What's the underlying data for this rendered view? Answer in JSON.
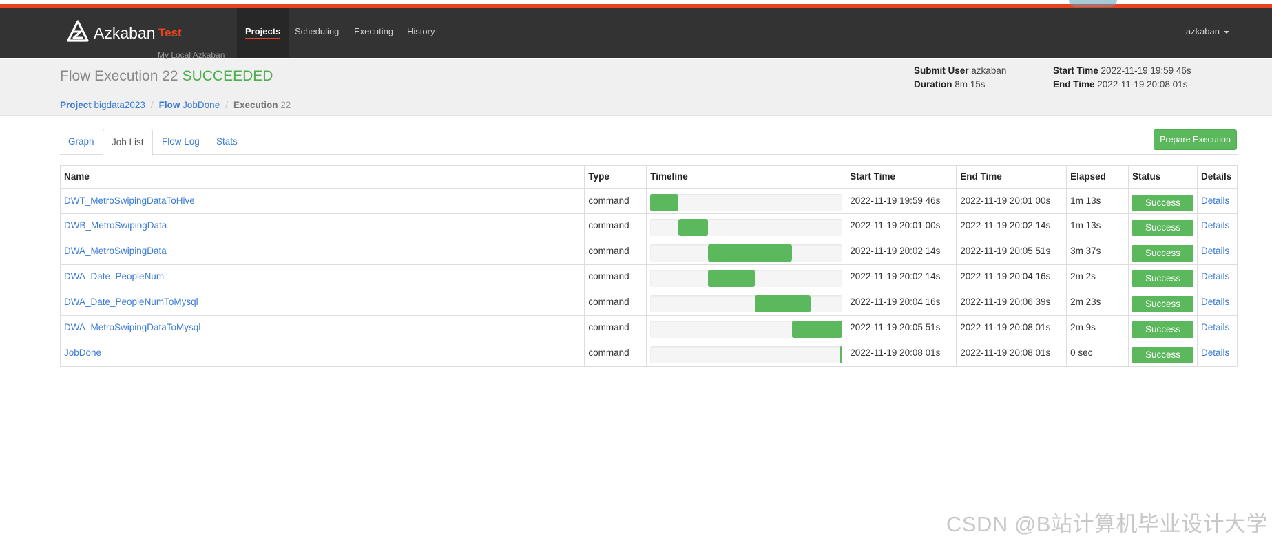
{
  "brand": {
    "name": "Azkaban",
    "env": "Test",
    "subtitle": "My Local Azkaban"
  },
  "nav": {
    "items": [
      {
        "label": "Projects",
        "active": true
      },
      {
        "label": "Scheduling",
        "active": false
      },
      {
        "label": "Executing",
        "active": false
      },
      {
        "label": "History",
        "active": false
      }
    ],
    "user": "azkaban"
  },
  "header": {
    "title": "Flow Execution 22",
    "status": "SUCCEEDED",
    "submit_user_label": "Submit User",
    "submit_user": "azkaban",
    "duration_label": "Duration",
    "duration": "8m 15s",
    "start_time_label": "Start Time",
    "start_time": "2022-11-19 19:59 46s",
    "end_time_label": "End Time",
    "end_time": "2022-11-19 20:08 01s"
  },
  "breadcrumb": {
    "project_label": "Project",
    "project": "bigdata2023",
    "flow_label": "Flow",
    "flow": "JobDone",
    "execution_label": "Execution",
    "execution": "22"
  },
  "tabs": [
    {
      "label": "Graph",
      "active": false
    },
    {
      "label": "Job List",
      "active": true
    },
    {
      "label": "Flow Log",
      "active": false
    },
    {
      "label": "Stats",
      "active": false
    }
  ],
  "prepare_button": "Prepare Execution",
  "table": {
    "columns": [
      "Name",
      "Type",
      "Timeline",
      "Start Time",
      "End Time",
      "Elapsed",
      "Status",
      "Details"
    ],
    "rows": [
      {
        "name": "DWT_MetroSwipingDataToHive",
        "type": "command",
        "timeline": {
          "start": 0.0,
          "end": 0.148
        },
        "start": "2022-11-19 19:59 46s",
        "end": "2022-11-19 20:01 00s",
        "elapsed": "1m 13s",
        "status": "Success",
        "details": "Details"
      },
      {
        "name": "DWB_MetroSwipingData",
        "type": "command",
        "timeline": {
          "start": 0.148,
          "end": 0.301
        },
        "start": "2022-11-19 20:01 00s",
        "end": "2022-11-19 20:02 14s",
        "elapsed": "1m 13s",
        "status": "Success",
        "details": "Details"
      },
      {
        "name": "DWA_MetroSwipingData",
        "type": "command",
        "timeline": {
          "start": 0.301,
          "end": 0.739
        },
        "start": "2022-11-19 20:02 14s",
        "end": "2022-11-19 20:05 51s",
        "elapsed": "3m 37s",
        "status": "Success",
        "details": "Details"
      },
      {
        "name": "DWA_Date_PeopleNum",
        "type": "command",
        "timeline": {
          "start": 0.301,
          "end": 0.545
        },
        "start": "2022-11-19 20:02 14s",
        "end": "2022-11-19 20:04 16s",
        "elapsed": "2m 2s",
        "status": "Success",
        "details": "Details"
      },
      {
        "name": "DWA_Date_PeopleNumToMysql",
        "type": "command",
        "timeline": {
          "start": 0.545,
          "end": 0.834
        },
        "start": "2022-11-19 20:04 16s",
        "end": "2022-11-19 20:06 39s",
        "elapsed": "2m 23s",
        "status": "Success",
        "details": "Details"
      },
      {
        "name": "DWA_MetroSwipingDataToMysql",
        "type": "command",
        "timeline": {
          "start": 0.739,
          "end": 1.0
        },
        "start": "2022-11-19 20:05 51s",
        "end": "2022-11-19 20:08 01s",
        "elapsed": "2m 9s",
        "status": "Success",
        "details": "Details"
      },
      {
        "name": "JobDone",
        "type": "command",
        "timeline": {
          "start": 0.99,
          "end": 1.0
        },
        "start": "2022-11-19 20:08 01s",
        "end": "2022-11-19 20:08 01s",
        "elapsed": "0 sec",
        "status": "Success",
        "details": "Details"
      }
    ]
  },
  "watermark": "CSDN @B站计算机毕业设计大学",
  "colors": {
    "accent": "#e84421",
    "success": "#5cb85c",
    "link": "#3a7bd5",
    "navbar": "#333333"
  }
}
